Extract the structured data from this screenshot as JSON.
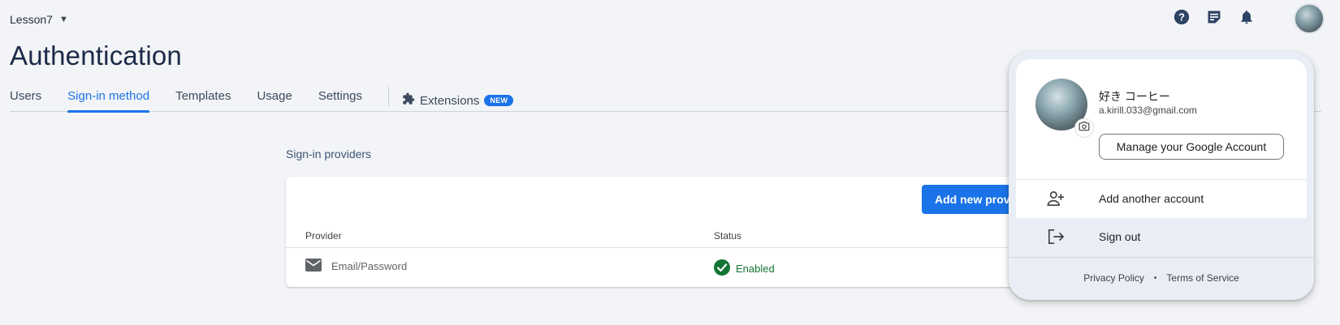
{
  "project": {
    "name": "Lesson7"
  },
  "page": {
    "title": "Authentication"
  },
  "tabs": [
    {
      "label": "Users",
      "active": false
    },
    {
      "label": "Sign-in method",
      "active": true
    },
    {
      "label": "Templates",
      "active": false
    },
    {
      "label": "Usage",
      "active": false
    },
    {
      "label": "Settings",
      "active": false
    }
  ],
  "extensions_tab": {
    "label": "Extensions",
    "badge": "NEW"
  },
  "top_icons": [
    "help-icon",
    "release-notes-icon",
    "notifications-icon"
  ],
  "providers": {
    "section_label": "Sign-in providers",
    "add_button": "Add new provi",
    "columns": {
      "provider": "Provider",
      "status": "Status"
    },
    "rows": [
      {
        "provider": "Email/Password",
        "status": "Enabled",
        "icon": "email-icon"
      }
    ]
  },
  "account_popup": {
    "name": "好き コーヒー",
    "email": "a.kirill.033@gmail.com",
    "manage_button": "Manage your Google Account",
    "add_account": "Add another account",
    "sign_out": "Sign out",
    "privacy": "Privacy Policy",
    "separator": "•",
    "terms": "Terms of Service"
  },
  "colors": {
    "accent": "#1a73e8",
    "title": "#1b2a47",
    "status_ok": "#137333",
    "background": "#f3f4f7",
    "popup_bg": "#e9eef6"
  }
}
